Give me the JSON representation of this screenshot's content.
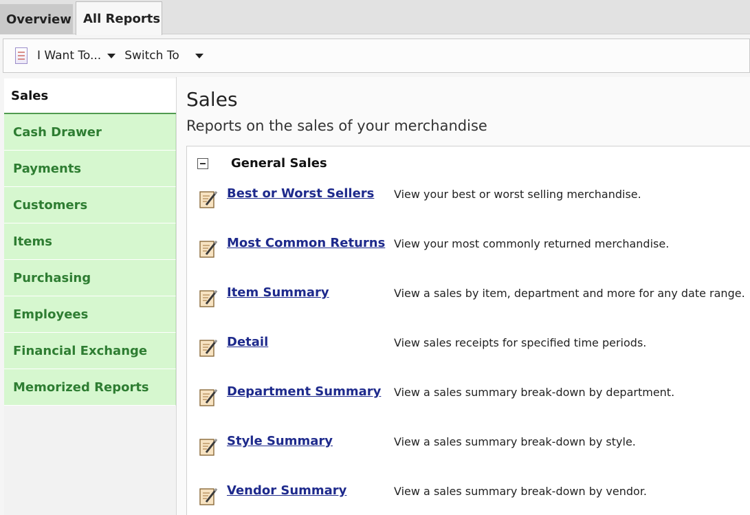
{
  "tabs": [
    {
      "label": "Overview"
    },
    {
      "label": "All Reports"
    }
  ],
  "toolbar": {
    "i_want_to": "I Want To...",
    "switch_to": "Switch To"
  },
  "sidebar": {
    "active": "Sales",
    "items": [
      {
        "label": "Cash Drawer"
      },
      {
        "label": "Payments"
      },
      {
        "label": "Customers"
      },
      {
        "label": "Items"
      },
      {
        "label": "Purchasing"
      },
      {
        "label": "Employees"
      },
      {
        "label": "Financial Exchange"
      },
      {
        "label": "Memorized Reports"
      }
    ]
  },
  "main": {
    "title": "Sales",
    "subtitle": "Reports on the sales of your merchandise",
    "section": "General Sales",
    "reports": [
      {
        "name": "Best or Worst Sellers",
        "desc": "View your best or worst selling merchandise."
      },
      {
        "name": "Most Common Returns",
        "desc": "View your most commonly returned merchandise."
      },
      {
        "name": "Item Summary",
        "desc": "View a sales by item, department and more for any date range."
      },
      {
        "name": "Detail",
        "desc": "View sales receipts for specified time periods."
      },
      {
        "name": "Department Summary",
        "desc": "View a sales summary break-down by department."
      },
      {
        "name": "Style Summary",
        "desc": "View a sales summary break-down by style."
      },
      {
        "name": "Vendor Summary",
        "desc": "View a sales summary break-down by vendor."
      }
    ]
  },
  "colors": {
    "sidebar_bg": "#d6f7cf",
    "sidebar_text": "#2e7d32",
    "link": "#1e2a8c"
  },
  "icons": {
    "toolbar": "report-list-icon",
    "report": "report-edit-icon"
  }
}
